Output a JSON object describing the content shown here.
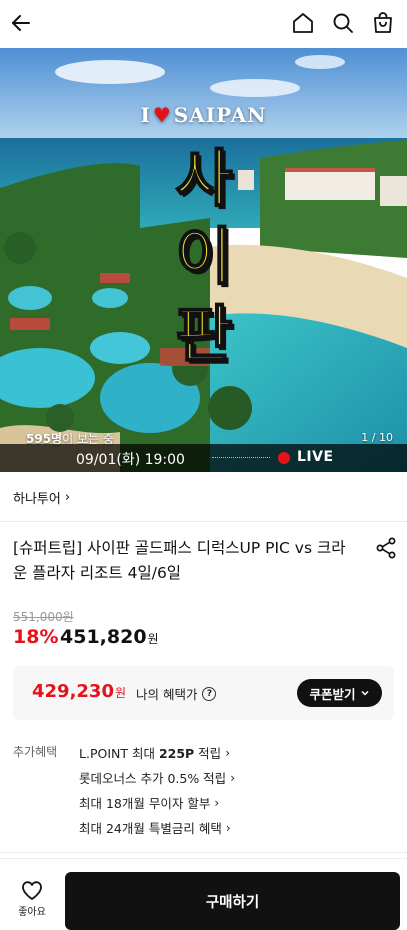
{
  "header": {
    "back_icon": "arrow-left-icon",
    "home_icon": "home-icon",
    "search_icon": "search-icon",
    "cart_icon": "shopping-bag-icon"
  },
  "hero": {
    "brand_prefix": "I",
    "brand_heart": "♥",
    "brand_name": "SAIPAN",
    "title_chars": [
      "사",
      "이",
      "판"
    ],
    "viewers_count": "595명",
    "viewers_suffix": "이 보는 중",
    "pager": "1 / 10",
    "live_time": "09/01(화) 19:00",
    "live_label": "LIVE",
    "colors": {
      "live_red": "#e4131b",
      "title_yellow": "#f5ea2a"
    }
  },
  "seller": {
    "name": "하나투어",
    "chevron": "›"
  },
  "product": {
    "title": "[슈퍼트립] 사이판 골드패스 디럭스UP PIC vs 크라운 플라자 리조트 4일/6일",
    "original_price": "551,000원",
    "discount_rate": "18%",
    "price": "451,820",
    "price_unit": "원"
  },
  "coupon": {
    "price": "429,230",
    "price_unit": "원",
    "benefit_label": "나의 혜택가",
    "help_icon": "?",
    "button_label": "쿠폰받기",
    "button_chevron": "⌄"
  },
  "extra": {
    "label": "추가혜택",
    "items": [
      {
        "prefix": "L.POINT 최대 ",
        "bold": "225P",
        "suffix": " 적립"
      },
      {
        "prefix": "롯데오너스 추가 0.5% 적립",
        "bold": "",
        "suffix": ""
      },
      {
        "prefix": "최대 18개월 무이자 할부",
        "bold": "",
        "suffix": ""
      },
      {
        "prefix": "최대 24개월 특별금리 혜택",
        "bold": "",
        "suffix": ""
      }
    ],
    "chevron": "›"
  },
  "bottom": {
    "like_label": "좋아요",
    "buy_label": "구매하기"
  }
}
